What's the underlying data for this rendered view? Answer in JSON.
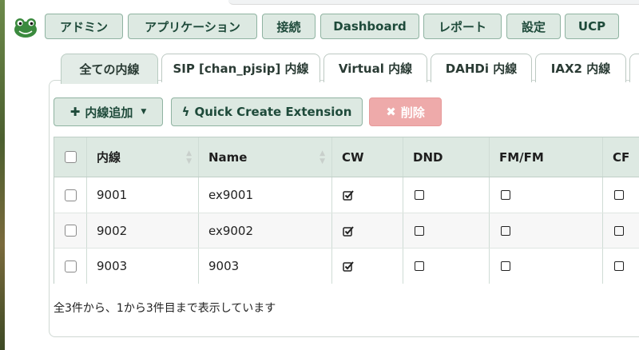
{
  "nav": {
    "items": [
      "アドミン",
      "アプリケーション",
      "接続",
      "Dashboard",
      "レポート",
      "設定",
      "UCP"
    ]
  },
  "tabs": [
    "全ての内線",
    "SIP [chan_pjsip] 内線",
    "Virtual 内線",
    "DAHDi 内線",
    "IAX2 内線"
  ],
  "toolbar": {
    "add_label": "内線追加",
    "quick_label": "Quick Create Extension",
    "delete_label": "削除"
  },
  "table": {
    "headers": [
      "内線",
      "Name",
      "CW",
      "DND",
      "FM/FM",
      "CF"
    ],
    "rows": [
      {
        "ext": "9001",
        "name": "ex9001",
        "cw": true,
        "dnd": false,
        "fmfm": false,
        "cf": false
      },
      {
        "ext": "9002",
        "name": "ex9002",
        "cw": true,
        "dnd": false,
        "fmfm": false,
        "cf": false
      },
      {
        "ext": "9003",
        "name": "9003",
        "cw": true,
        "dnd": false,
        "fmfm": false,
        "cf": false
      }
    ]
  },
  "footer": {
    "summary": "全3件から、1から3件目まで表示しています"
  },
  "colors": {
    "button_bg": "#dde9e2",
    "button_text": "#1e4a3a",
    "danger": "#eeaaaa"
  }
}
